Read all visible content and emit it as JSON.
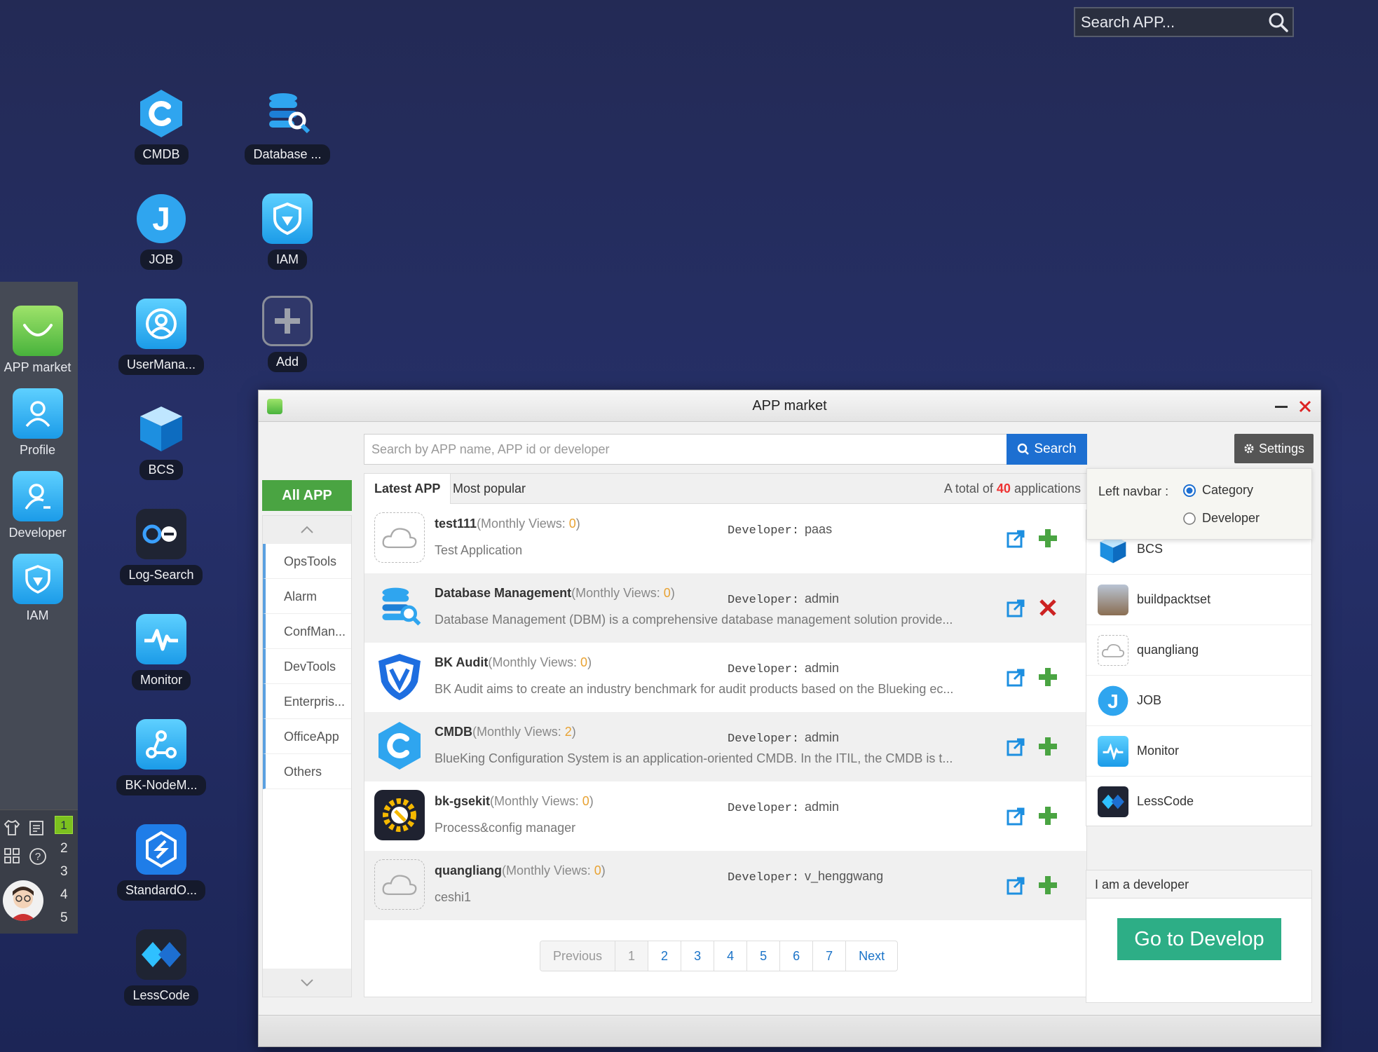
{
  "desktop_search": {
    "placeholder": "Search APP..."
  },
  "dock": {
    "items": [
      {
        "label": "APP market",
        "icon": "bag-icon"
      },
      {
        "label": "Profile",
        "icon": "user-icon"
      },
      {
        "label": "Developer",
        "icon": "developer-icon"
      },
      {
        "label": "IAM",
        "icon": "shield-icon"
      }
    ],
    "desktop_numbers": [
      "1",
      "2",
      "3",
      "4",
      "5"
    ]
  },
  "desktop_icons": [
    {
      "label": "CMDB"
    },
    {
      "label": "Database ..."
    },
    {
      "label": "JOB"
    },
    {
      "label": "IAM"
    },
    {
      "label": "UserMana..."
    },
    {
      "label": "Add"
    },
    {
      "label": "BCS"
    },
    {
      "label": "Log-Search"
    },
    {
      "label": "Monitor"
    },
    {
      "label": "BK-NodeM..."
    },
    {
      "label": "StandardO..."
    },
    {
      "label": "LessCode"
    }
  ],
  "window": {
    "title": "APP market",
    "search_placeholder": "Search by APP name, APP id or developer",
    "search_button": "Search",
    "settings_button": "Settings",
    "all_app": "All APP",
    "categories": [
      "OpsTools",
      "Alarm",
      "ConfMan...",
      "DevTools",
      "Enterpris...",
      "OfficeApp",
      "Others"
    ],
    "tabs": [
      "Latest APP",
      "Most popular"
    ],
    "total_prefix": "A total of",
    "total_count": "40",
    "total_suffix": "applications",
    "monthly_views_label": "(Monthly Views: ",
    "developer_label": "Developer:",
    "apps": [
      {
        "name": "test111",
        "views": "0",
        "developer": "paas",
        "desc": "Test Application",
        "action": "add"
      },
      {
        "name": "Database Management",
        "views": "0",
        "developer": "admin",
        "desc": "Database Management (DBM) is a comprehensive database management solution provide...",
        "action": "remove"
      },
      {
        "name": "BK Audit",
        "views": "0",
        "developer": "admin",
        "desc": "BK Audit aims to create an industry benchmark for audit products based on the Blueking ec...",
        "action": "add"
      },
      {
        "name": "CMDB",
        "views": "2",
        "developer": "admin",
        "desc": "BlueKing Configuration System is an application-oriented CMDB. In the ITIL, the CMDB is t...",
        "action": "add"
      },
      {
        "name": "bk-gsekit",
        "views": "0",
        "developer": "admin",
        "desc": "Process&config manager",
        "action": "add"
      },
      {
        "name": "quangliang",
        "views": "0",
        "developer": "v_henggwang",
        "desc": "ceshi1",
        "action": "add"
      }
    ],
    "pagination": [
      "Previous",
      "1",
      "2",
      "3",
      "4",
      "5",
      "6",
      "7",
      "Next"
    ],
    "settings_popup": {
      "label": "Left navbar :",
      "options": [
        "Category",
        "Developer"
      ],
      "selected": "Category"
    },
    "recent_apps": [
      "BCS",
      "buildpacktset",
      "quangliang",
      "JOB",
      "Monitor",
      "LessCode"
    ],
    "developer_section": {
      "title": "I am a developer",
      "button": "Go to Develop"
    }
  },
  "colors": {
    "accent_blue": "#1d6fd1",
    "green": "#4aa442",
    "develop_green": "#2dae86",
    "views_orange": "#e8a232",
    "count_red": "#e33333"
  }
}
